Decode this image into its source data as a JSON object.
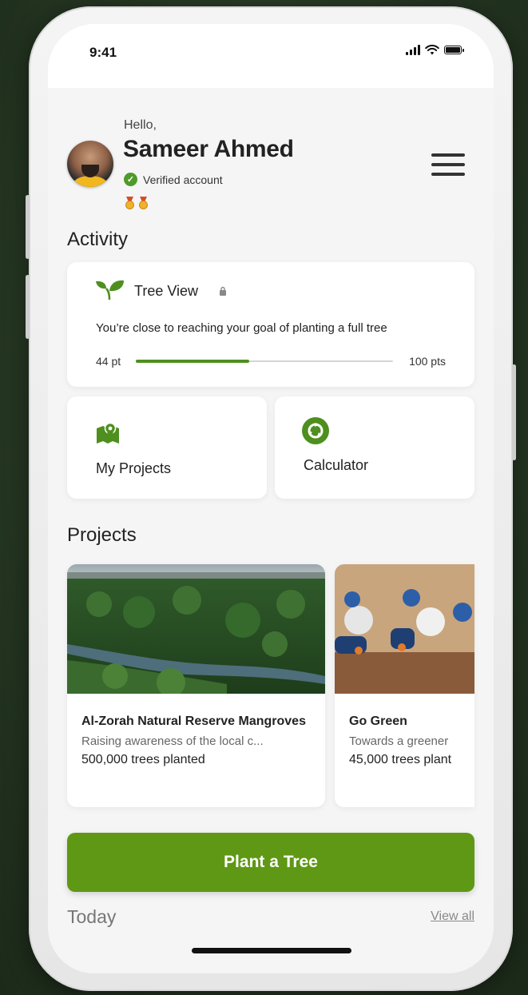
{
  "status_bar": {
    "time": "9:41"
  },
  "header": {
    "greeting": "Hello,",
    "user_name": "Sameer Ahmed",
    "verified_label": "Verified account",
    "badges": [
      "medal-icon",
      "medal-icon"
    ]
  },
  "activity": {
    "title": "Activity",
    "tree_view": {
      "title": "Tree View",
      "description": "You’re close to reaching your goal of planting a full tree",
      "current_label": "44 pt",
      "goal_label": "100 pts",
      "progress": 0.44
    },
    "tiles": [
      {
        "label": "My Projects",
        "icon": "map-pin-icon"
      },
      {
        "label": "Calculator",
        "icon": "recycle-icon"
      }
    ]
  },
  "projects": {
    "title": "Projects",
    "items": [
      {
        "title": "Al-Zorah Natural Reserve Mangroves",
        "subtitle": "Raising awareness of the local c...",
        "count": "500,000  trees planted"
      },
      {
        "title": "Go Green",
        "subtitle": "Towards a greener",
        "count": "45,000 trees plant"
      }
    ]
  },
  "cta": {
    "label": "Plant a Tree"
  },
  "today": {
    "title": "Today",
    "view_all": "View all"
  },
  "colors": {
    "brand_green": "#5f9815",
    "progress_green": "#4e8f1e",
    "verified_green": "#4e9a2b"
  }
}
